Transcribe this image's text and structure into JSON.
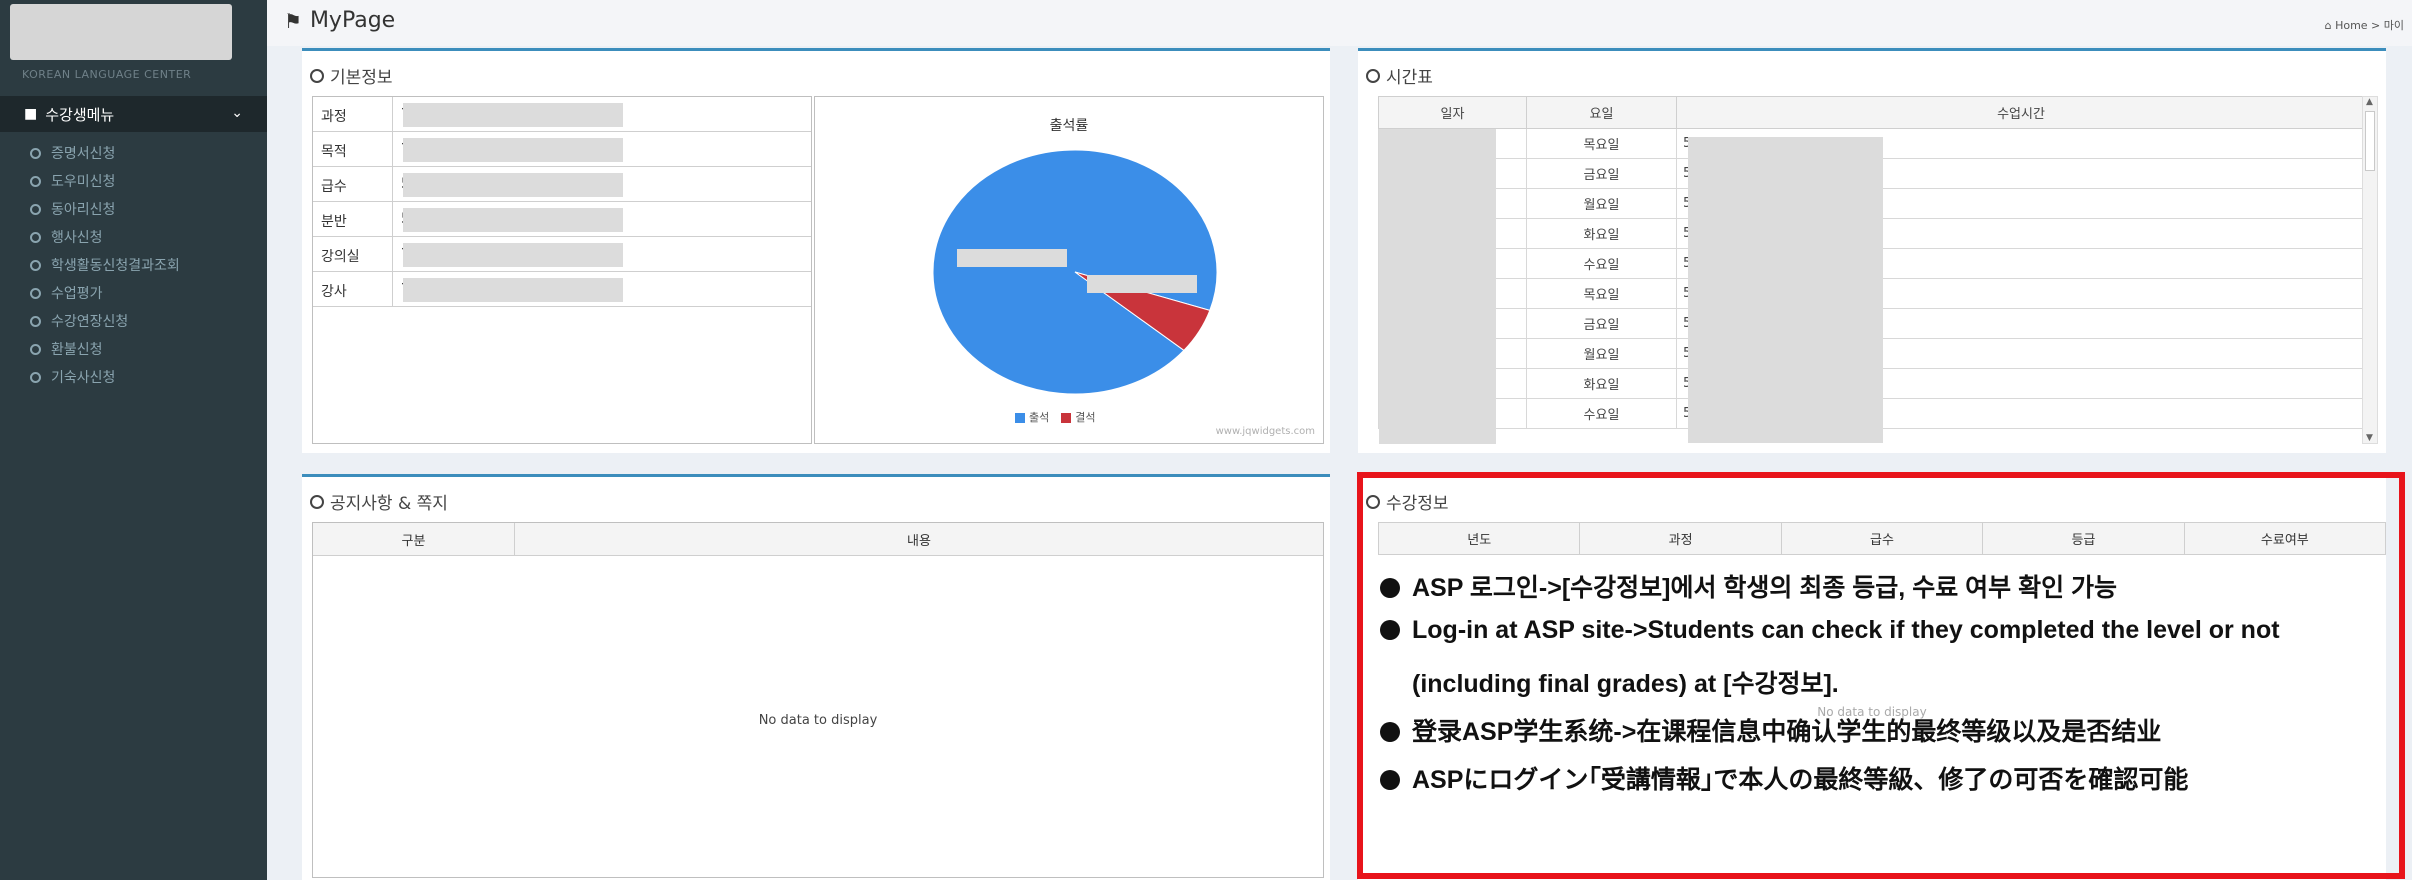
{
  "header": {
    "title": "MyPage",
    "breadcrumb": "Home > 마이"
  },
  "sidebar": {
    "center_label": "KOREAN LANGUAGE CENTER",
    "menu_title": "수강생메뉴",
    "items": [
      "증명서신청",
      "도우미신청",
      "동아리신청",
      "행사신청",
      "학생활동신청결과조회",
      "수업평가",
      "수강연장신청",
      "환불신청",
      "기숙사신청"
    ]
  },
  "basic_info": {
    "title": "기본정보",
    "labels": [
      "과정",
      "목적",
      "급수",
      "분반",
      "강의실",
      "강사"
    ],
    "values": [
      "?",
      "?",
      "5",
      "5",
      "?",
      "?"
    ]
  },
  "chart_data": {
    "type": "pie",
    "title": "출석률",
    "categories": [
      "출석",
      "결석"
    ],
    "values": [
      94,
      6
    ],
    "colors": [
      "#3b8ee8",
      "#c9343b"
    ],
    "legend": "bottom",
    "watermark": "www.jqwidgets.com"
  },
  "timetable": {
    "title": "시간표",
    "headers": [
      "일자",
      "요일",
      "수업시간"
    ],
    "rows": [
      {
        "day": "목요일",
        "time": "5."
      },
      {
        "day": "금요일",
        "time": "5."
      },
      {
        "day": "월요일",
        "time": "5."
      },
      {
        "day": "화요일",
        "time": "5."
      },
      {
        "day": "수요일",
        "time": "5."
      },
      {
        "day": "목요일",
        "time": "5."
      },
      {
        "day": "금요일",
        "time": "5."
      },
      {
        "day": "월요일",
        "time": "5."
      },
      {
        "day": "화요일",
        "time": "5."
      },
      {
        "day": "수요일",
        "time": "5."
      }
    ]
  },
  "notice": {
    "title": "공지사항 & 쪽지",
    "headers": [
      "구분",
      "내용"
    ],
    "empty": "No data to display"
  },
  "course": {
    "title": "수강정보",
    "headers": [
      "년도",
      "과정",
      "급수",
      "등급",
      "수료여부"
    ],
    "empty": "No data to display"
  },
  "annotation": {
    "lines": [
      "ASP 로그인->[수강정보]에서 학생의 최종 등급, 수료 여부 확인 가능",
      "Log-in at ASP site->Students can check if they completed the level or not",
      "(including final grades) at [수강정보].",
      "登录ASP学生系统->在课程信息中确认学生的最终等级以及是否结业",
      "ASPにログイン｢受講情報｣で本人の最終等級、修了の可否を確認可能"
    ]
  },
  "colors": {
    "accent": "#3c8dbc",
    "sidebar": "#2c3b41",
    "highlight": "#e8141b"
  }
}
